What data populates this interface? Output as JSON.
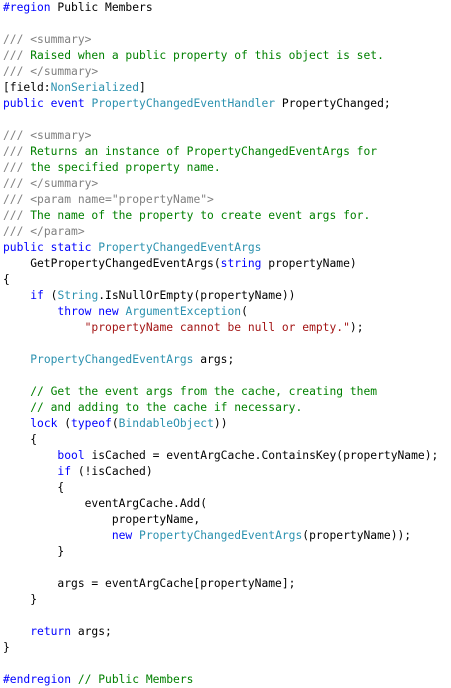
{
  "editor": {
    "language": "C#",
    "colors": {
      "keyword": "#0000ff",
      "comment": "#008000",
      "doc_tag": "#808080",
      "type": "#2b91af",
      "string": "#a31515",
      "plain": "#000000"
    },
    "lines": [
      [
        {
          "t": "kw",
          "v": "#region"
        },
        {
          "t": "pl",
          "v": " Public Members"
        }
      ],
      [],
      [
        {
          "t": "doc",
          "v": "///"
        },
        {
          "t": "cm",
          "v": " "
        },
        {
          "t": "doc",
          "v": "<summary>"
        }
      ],
      [
        {
          "t": "doc",
          "v": "///"
        },
        {
          "t": "cm",
          "v": " Raised when a public property of this object is set."
        }
      ],
      [
        {
          "t": "doc",
          "v": "///"
        },
        {
          "t": "cm",
          "v": " "
        },
        {
          "t": "doc",
          "v": "</summary>"
        }
      ],
      [
        {
          "t": "pl",
          "v": "[field:"
        },
        {
          "t": "ty",
          "v": "NonSerialized"
        },
        {
          "t": "pl",
          "v": "]"
        }
      ],
      [
        {
          "t": "kw",
          "v": "public"
        },
        {
          "t": "pl",
          "v": " "
        },
        {
          "t": "kw",
          "v": "event"
        },
        {
          "t": "pl",
          "v": " "
        },
        {
          "t": "ty",
          "v": "PropertyChangedEventHandler"
        },
        {
          "t": "pl",
          "v": " PropertyChanged;"
        }
      ],
      [],
      [
        {
          "t": "doc",
          "v": "///"
        },
        {
          "t": "cm",
          "v": " "
        },
        {
          "t": "doc",
          "v": "<summary>"
        }
      ],
      [
        {
          "t": "doc",
          "v": "///"
        },
        {
          "t": "cm",
          "v": " Returns an instance of PropertyChangedEventArgs for"
        }
      ],
      [
        {
          "t": "doc",
          "v": "///"
        },
        {
          "t": "cm",
          "v": " the specified property name."
        }
      ],
      [
        {
          "t": "doc",
          "v": "///"
        },
        {
          "t": "cm",
          "v": " "
        },
        {
          "t": "doc",
          "v": "</summary>"
        }
      ],
      [
        {
          "t": "doc",
          "v": "///"
        },
        {
          "t": "cm",
          "v": " "
        },
        {
          "t": "doc",
          "v": "<param name=\"propertyName\">"
        }
      ],
      [
        {
          "t": "doc",
          "v": "///"
        },
        {
          "t": "cm",
          "v": " The name of the property to create event args for."
        }
      ],
      [
        {
          "t": "doc",
          "v": "///"
        },
        {
          "t": "cm",
          "v": " "
        },
        {
          "t": "doc",
          "v": "</param>"
        }
      ],
      [
        {
          "t": "kw",
          "v": "public"
        },
        {
          "t": "pl",
          "v": " "
        },
        {
          "t": "kw",
          "v": "static"
        },
        {
          "t": "pl",
          "v": " "
        },
        {
          "t": "ty",
          "v": "PropertyChangedEventArgs"
        }
      ],
      [
        {
          "t": "pl",
          "v": "    GetPropertyChangedEventArgs("
        },
        {
          "t": "kw",
          "v": "string"
        },
        {
          "t": "pl",
          "v": " propertyName)"
        }
      ],
      [
        {
          "t": "pl",
          "v": "{"
        }
      ],
      [
        {
          "t": "pl",
          "v": "    "
        },
        {
          "t": "kw",
          "v": "if"
        },
        {
          "t": "pl",
          "v": " ("
        },
        {
          "t": "ty",
          "v": "String"
        },
        {
          "t": "pl",
          "v": ".IsNullOrEmpty(propertyName))"
        }
      ],
      [
        {
          "t": "pl",
          "v": "        "
        },
        {
          "t": "kw",
          "v": "throw"
        },
        {
          "t": "pl",
          "v": " "
        },
        {
          "t": "kw",
          "v": "new"
        },
        {
          "t": "pl",
          "v": " "
        },
        {
          "t": "ty",
          "v": "ArgumentException"
        },
        {
          "t": "pl",
          "v": "("
        }
      ],
      [
        {
          "t": "pl",
          "v": "            "
        },
        {
          "t": "st",
          "v": "\"propertyName cannot be null or empty.\""
        },
        {
          "t": "pl",
          "v": ");"
        }
      ],
      [],
      [
        {
          "t": "pl",
          "v": "    "
        },
        {
          "t": "ty",
          "v": "PropertyChangedEventArgs"
        },
        {
          "t": "pl",
          "v": " args;"
        }
      ],
      [],
      [
        {
          "t": "pl",
          "v": "    "
        },
        {
          "t": "cm",
          "v": "// Get the event args from the cache, creating them"
        }
      ],
      [
        {
          "t": "pl",
          "v": "    "
        },
        {
          "t": "cm",
          "v": "// and adding to the cache if necessary."
        }
      ],
      [
        {
          "t": "pl",
          "v": "    "
        },
        {
          "t": "kw",
          "v": "lock"
        },
        {
          "t": "pl",
          "v": " ("
        },
        {
          "t": "kw",
          "v": "typeof"
        },
        {
          "t": "pl",
          "v": "("
        },
        {
          "t": "ty",
          "v": "BindableObject"
        },
        {
          "t": "pl",
          "v": "))"
        }
      ],
      [
        {
          "t": "pl",
          "v": "    {"
        }
      ],
      [
        {
          "t": "pl",
          "v": "        "
        },
        {
          "t": "kw",
          "v": "bool"
        },
        {
          "t": "pl",
          "v": " isCached = eventArgCache.ContainsKey(propertyName);"
        }
      ],
      [
        {
          "t": "pl",
          "v": "        "
        },
        {
          "t": "kw",
          "v": "if"
        },
        {
          "t": "pl",
          "v": " (!isCached)"
        }
      ],
      [
        {
          "t": "pl",
          "v": "        {"
        }
      ],
      [
        {
          "t": "pl",
          "v": "            eventArgCache.Add("
        }
      ],
      [
        {
          "t": "pl",
          "v": "                propertyName,"
        }
      ],
      [
        {
          "t": "pl",
          "v": "                "
        },
        {
          "t": "kw",
          "v": "new"
        },
        {
          "t": "pl",
          "v": " "
        },
        {
          "t": "ty",
          "v": "PropertyChangedEventArgs"
        },
        {
          "t": "pl",
          "v": "(propertyName));"
        }
      ],
      [
        {
          "t": "pl",
          "v": "        }"
        }
      ],
      [],
      [
        {
          "t": "pl",
          "v": "        args = eventArgCache[propertyName];"
        }
      ],
      [
        {
          "t": "pl",
          "v": "    }"
        }
      ],
      [],
      [
        {
          "t": "pl",
          "v": "    "
        },
        {
          "t": "kw",
          "v": "return"
        },
        {
          "t": "pl",
          "v": " args;"
        }
      ],
      [
        {
          "t": "pl",
          "v": "}"
        }
      ],
      [],
      [
        {
          "t": "kw",
          "v": "#endregion"
        },
        {
          "t": "pl",
          "v": " "
        },
        {
          "t": "cm",
          "v": "// Public Members"
        }
      ]
    ]
  }
}
